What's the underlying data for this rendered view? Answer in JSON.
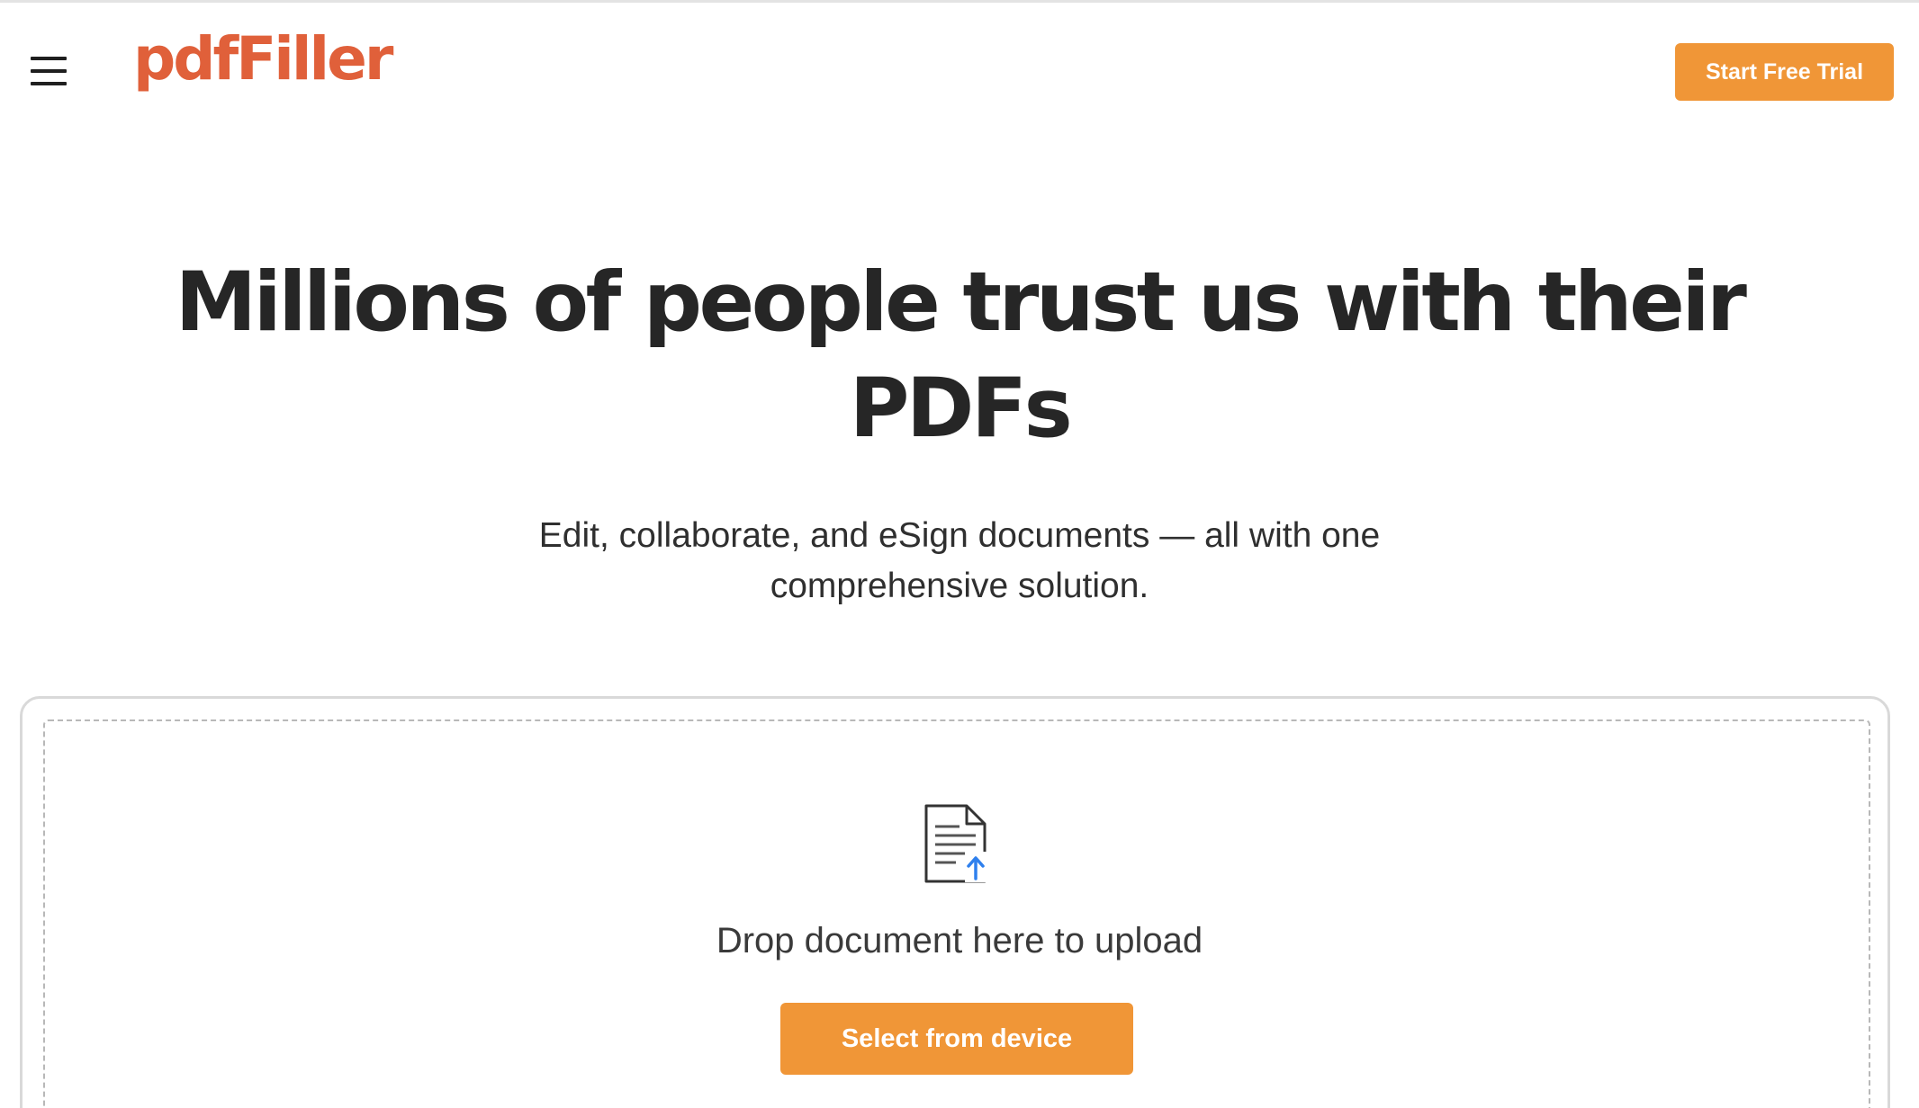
{
  "header": {
    "menu_icon": "hamburger-menu-icon",
    "logo_text": "pdfFiller",
    "trial_button_label": "Start Free Trial"
  },
  "hero": {
    "title": "Millions of people trust us with their PDFs",
    "subtitle": "Edit, collaborate, and eSign documents — all with one comprehensive solution."
  },
  "upload": {
    "icon": "document-upload-icon",
    "drop_text": "Drop document here to upload",
    "select_button_label": "Select from device"
  },
  "colors": {
    "brand": "#e0603a",
    "accent_button": "#f09637",
    "upload_arrow": "#2f80ed",
    "text_dark": "#262626"
  }
}
